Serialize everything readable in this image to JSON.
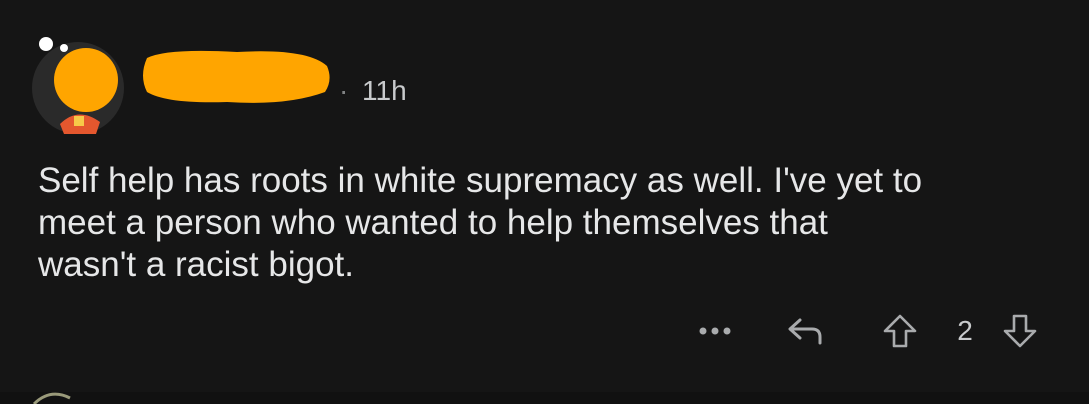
{
  "comment": {
    "timestamp": "11h",
    "separator": "·",
    "body": "Self help has roots in white supremacy as well. I've yet to\nmeet a person who wanted to help themselves that\nwasn't a racist bigot.",
    "score": "2"
  },
  "actions": {
    "more": "more-options-icon",
    "reply": "reply-icon",
    "upvote": "upvote-arrow-icon",
    "downvote": "downvote-arrow-icon"
  },
  "colors": {
    "background": "#151515",
    "redaction": "#ffa500",
    "text": "#e6e7e8",
    "muted": "#a9abad"
  }
}
